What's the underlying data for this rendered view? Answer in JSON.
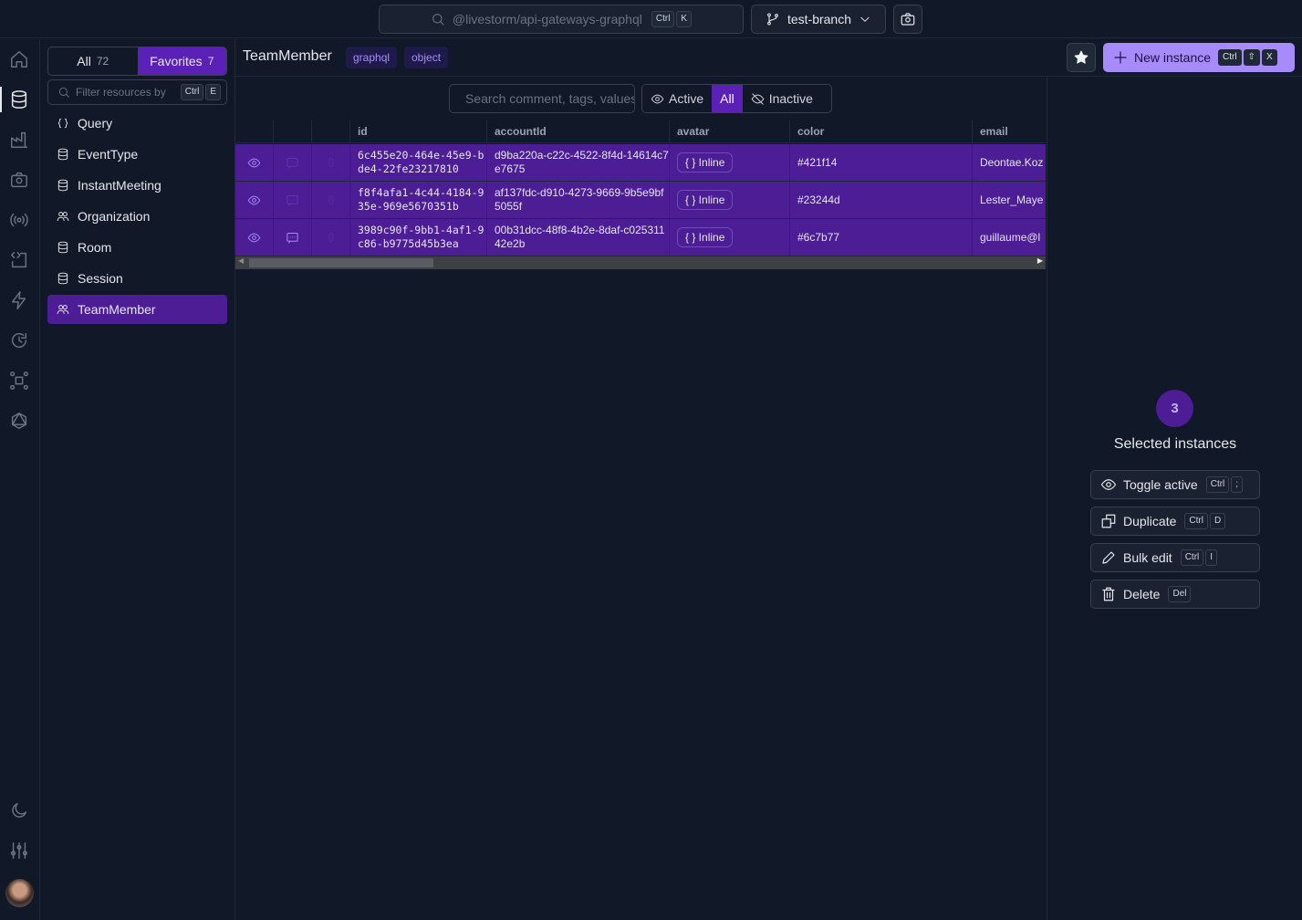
{
  "topbar": {
    "project": "@livestorm/api-gateways-graphql",
    "shortcut": [
      "Ctrl",
      "K"
    ],
    "branch": "test-branch"
  },
  "rail": {
    "top": [
      "home-icon",
      "database-icon",
      "factory-icon",
      "camera-icon",
      "broadcast-icon",
      "code-file-icon",
      "lightning-icon",
      "history-icon",
      "network-icon",
      "graphql-icon"
    ],
    "bottom": [
      "moon-icon",
      "sliders-icon",
      "avatar"
    ]
  },
  "sidebar": {
    "tabs": [
      {
        "label": "All",
        "count": "72"
      },
      {
        "label": "Favorites",
        "count": "7"
      }
    ],
    "filter_placeholder": "Filter resources by",
    "filter_shortcut": [
      "Ctrl",
      "E"
    ],
    "items": [
      {
        "label": "Query",
        "icon": "braces-icon"
      },
      {
        "label": "EventType",
        "icon": "database-icon"
      },
      {
        "label": "InstantMeeting",
        "icon": "database-icon"
      },
      {
        "label": "Organization",
        "icon": "users-icon"
      },
      {
        "label": "Room",
        "icon": "database-icon"
      },
      {
        "label": "Session",
        "icon": "database-icon"
      },
      {
        "label": "TeamMember",
        "icon": "users-icon",
        "selected": true
      }
    ]
  },
  "header": {
    "title": "TeamMember",
    "tags": [
      "graphql",
      "object"
    ],
    "new_label": "New instance",
    "new_shortcut": [
      "Ctrl",
      "⇧",
      "X"
    ]
  },
  "filters": {
    "search_placeholder": "Search comment, tags, values",
    "segments": [
      "Active",
      "All",
      "Inactive"
    ],
    "active_segment": "All"
  },
  "table": {
    "columns": [
      "id",
      "accountId",
      "avatar",
      "color",
      "email"
    ],
    "rows": [
      {
        "id": "6c455e20-464e-45e9-bde4-22fe23217810",
        "accountId": "d9ba220a-c22c-4522-8f4d-14614c7e7675",
        "avatar": "{ } Inline",
        "color": "#421f14",
        "email": "Deontae.Koz",
        "has_comment": false
      },
      {
        "id": "f8f4afa1-4c44-4184-935e-969e5670351b",
        "accountId": "af137fdc-d910-4273-9669-9b5e9bf5055f",
        "avatar": "{ } Inline",
        "color": "#23244d",
        "email": "Lester_Maye",
        "has_comment": false
      },
      {
        "id": "3989c90f-9bb1-4af1-9c86-b9775d45b3ea",
        "accountId": "00b31dcc-48f8-4b2e-8daf-c02531142e2b",
        "avatar": "{ } Inline",
        "color": "#6c7b77",
        "email": "guillaume@l",
        "has_comment": true
      }
    ]
  },
  "selection": {
    "count": "3",
    "title": "Selected instances",
    "actions": [
      {
        "label": "Toggle active",
        "keys": [
          "Ctrl",
          ";"
        ],
        "icon": "eye-icon"
      },
      {
        "label": "Duplicate",
        "keys": [
          "Ctrl",
          "D"
        ],
        "icon": "duplicate-icon"
      },
      {
        "label": "Bulk edit",
        "keys": [
          "Ctrl",
          "I"
        ],
        "icon": "pencil-icon"
      },
      {
        "label": "Delete",
        "keys": [
          "Del"
        ],
        "icon": "trash-icon"
      }
    ]
  },
  "colors": {
    "accent": "#5b21b6",
    "selected_row": "#4c1d95",
    "primary_button": "#a78bfa",
    "background": "#111827"
  }
}
